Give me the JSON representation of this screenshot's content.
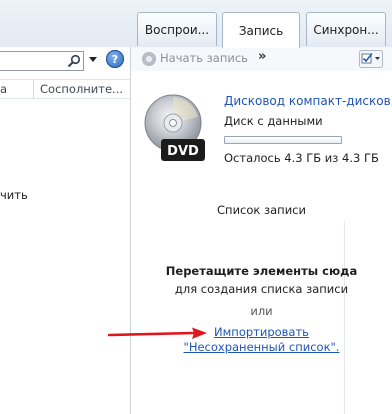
{
  "tabs": [
    {
      "label": "Воспрои..."
    },
    {
      "label": "Запись"
    },
    {
      "label": "Синхрон..."
    }
  ],
  "left_pane": {
    "column_left_fragment": "а",
    "column_contributor": "Сосполните...",
    "row_fragment": "чить"
  },
  "toolbar": {
    "start_burn_label": "Начать запись",
    "more_label": "»"
  },
  "disc": {
    "drive_name": "Дисковод компакт-дисков...",
    "disc_type": "Диск с данными",
    "space_left": "Осталось 4.3 ГБ из 4.3 ГБ",
    "used_fraction": 0,
    "badge": "DVD"
  },
  "burn_list": {
    "title": "Список записи",
    "drag_here": "Перетащите элементы сюда",
    "create_list": "для создания списка записи",
    "or": "или",
    "import_link": "Импортировать",
    "unsaved_link": "\"Несохраненный список\"."
  },
  "colors": {
    "link": "#1f55b5",
    "arrow": "#e0161d",
    "progress": "#5aa84e"
  },
  "icons": [
    "search-icon",
    "dropdown-chevron-icon",
    "help-icon",
    "burn-disc-icon",
    "options-icon",
    "dvd-disc-icon",
    "red-arrow-icon"
  ]
}
